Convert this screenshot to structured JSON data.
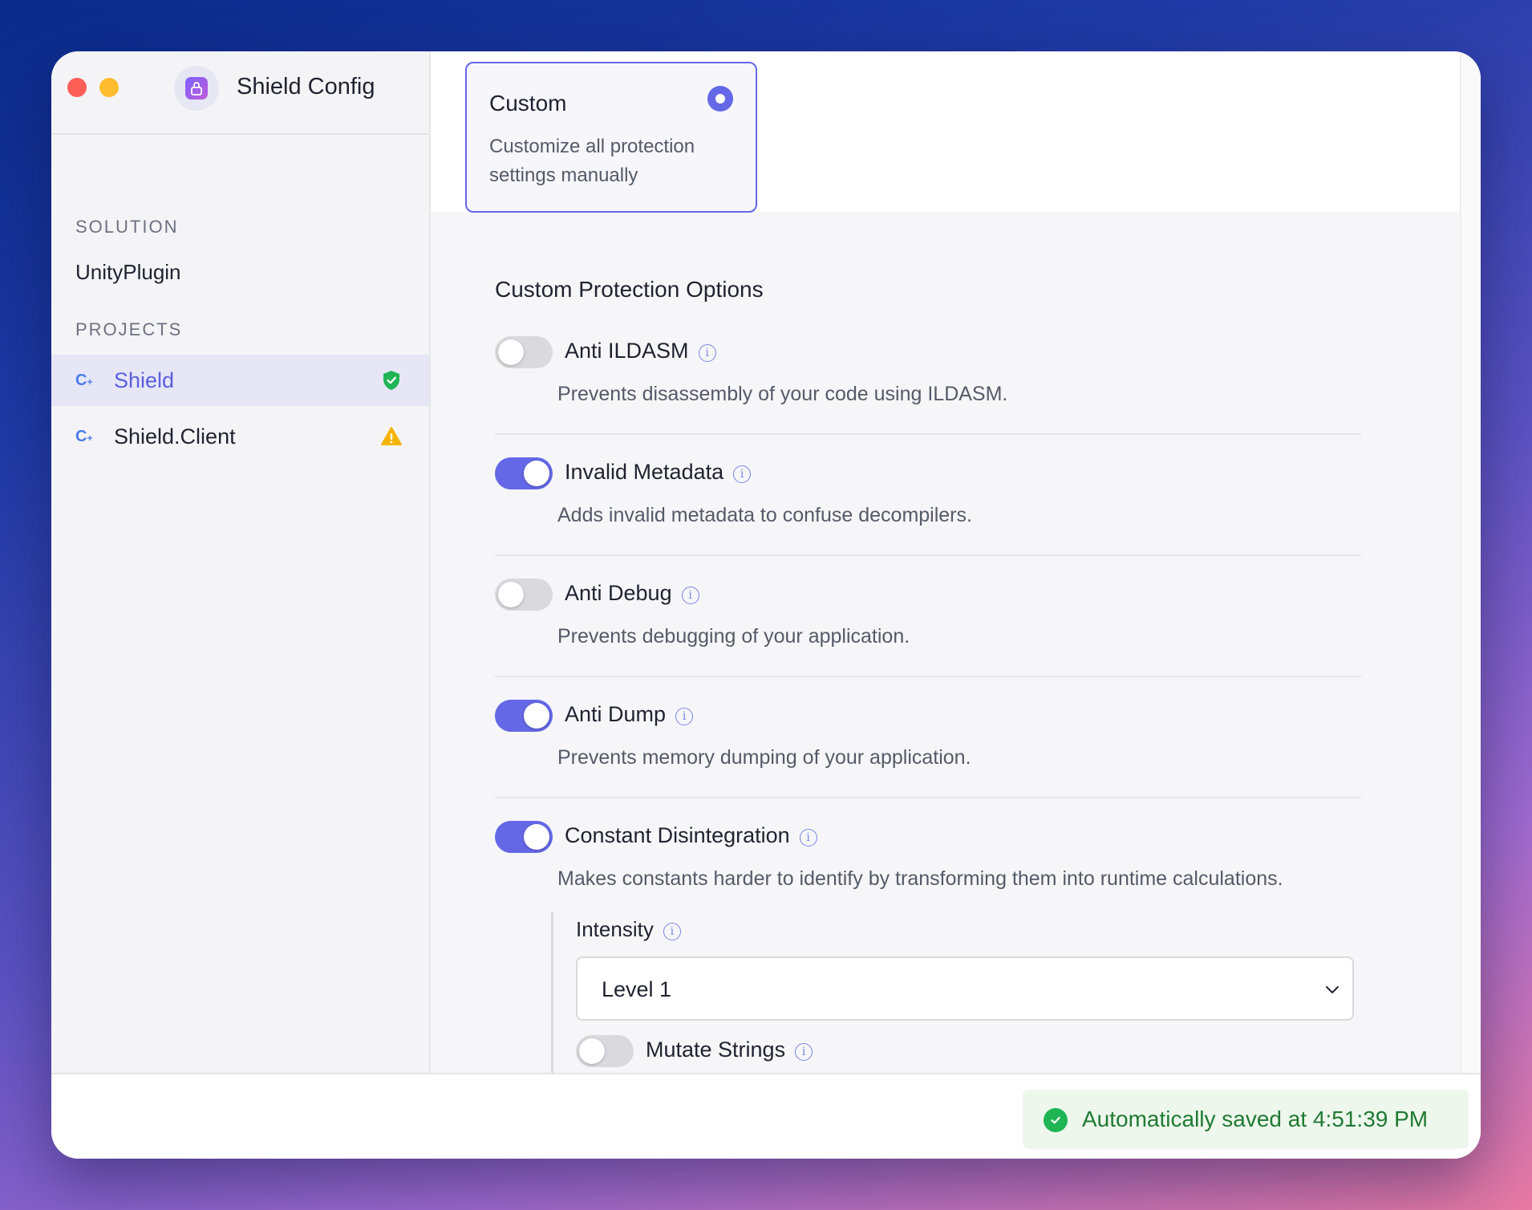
{
  "app": {
    "title": "Shield Config"
  },
  "sidebar": {
    "solution_label": "SOLUTION",
    "solution_name": "UnityPlugin",
    "projects_label": "PROJECTS",
    "projects": [
      {
        "label": "Shield",
        "icon": "csharp-icon",
        "status": "protected",
        "status_icon": "shield-check-icon",
        "status_color": "#1fb554",
        "selected": true
      },
      {
        "label": "Shield.Client",
        "icon": "csharp-icon",
        "status": "warning",
        "status_icon": "warning-icon",
        "status_color": "#f5b400",
        "selected": false
      }
    ]
  },
  "preset_card": {
    "title": "Custom",
    "description": "Customize all protection settings manually",
    "selected": true
  },
  "options": {
    "title": "Custom Protection Options",
    "items": [
      {
        "label": "Anti ILDASM",
        "description": "Prevents disassembly of your code using ILDASM.",
        "enabled": false
      },
      {
        "label": "Invalid Metadata",
        "description": "Adds invalid metadata to confuse decompilers.",
        "enabled": true
      },
      {
        "label": "Anti Debug",
        "description": "Prevents debugging of your application.",
        "enabled": false
      },
      {
        "label": "Anti Dump",
        "description": "Prevents memory dumping of your application.",
        "enabled": true
      },
      {
        "label": "Constant Disintegration",
        "description": "Makes constants harder to identify by transforming them into runtime calculations.",
        "enabled": true
      }
    ],
    "sub": {
      "intensity_label": "Intensity",
      "intensity_value": "Level 1",
      "mutate_label": "Mutate Strings",
      "mutate_enabled": false
    }
  },
  "footer": {
    "save_status": "Automatically saved at 4:51:39 PM",
    "accent": "#6468e6"
  }
}
